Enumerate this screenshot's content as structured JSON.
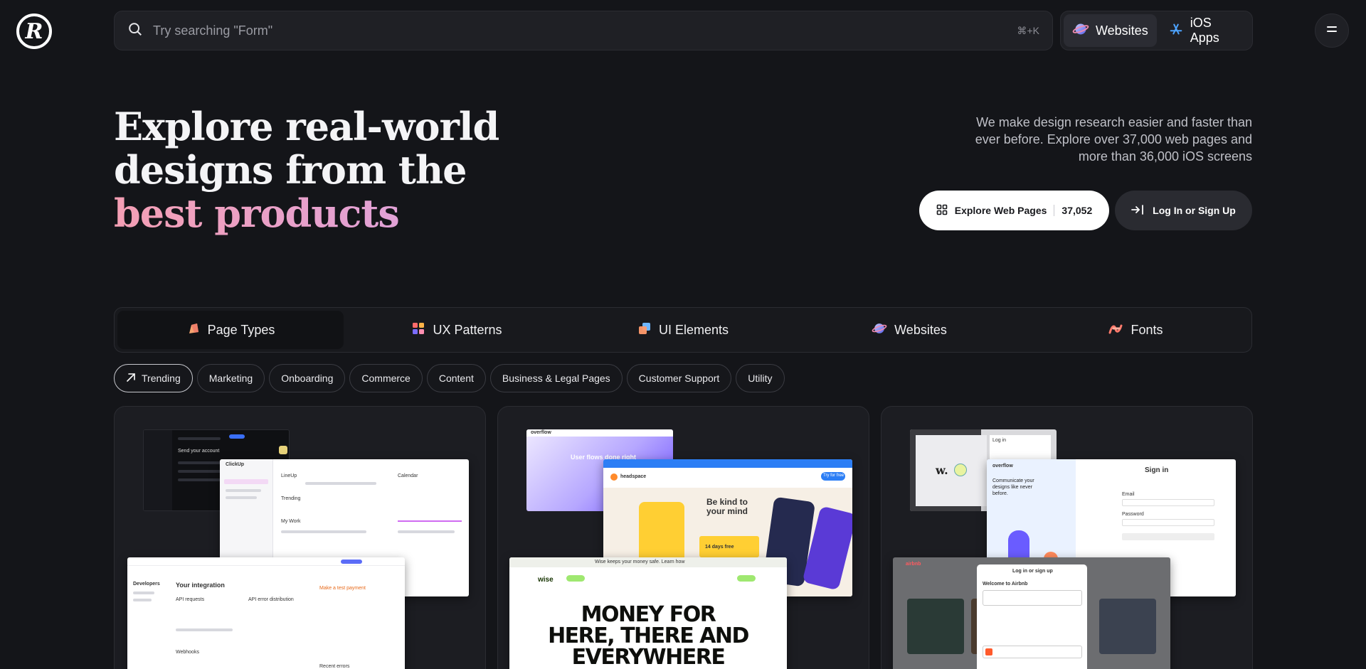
{
  "header": {
    "logo_letter": "R",
    "search": {
      "placeholder": "Try searching \"Form\"",
      "shortcut": "⌘+K",
      "icon": "search-icon"
    },
    "platforms": [
      {
        "label": "Websites",
        "icon": "planet-icon",
        "active": true
      },
      {
        "label": "iOS Apps",
        "icon": "app-store-icon",
        "active": false
      }
    ],
    "menu_icon": "menu-icon"
  },
  "hero": {
    "title_line1": "Explore real-world",
    "title_line2": "designs from the",
    "title_highlight": "best products",
    "description": "We make design research easier and faster than ever before. Explore over 37,000 web pages and more than 36,000 iOS screens",
    "explore_button": {
      "label": "Explore Web Pages",
      "count": "37,052",
      "icon": "grid-icon"
    },
    "login_button": {
      "label": "Log In or Sign Up",
      "icon": "login-arrow-icon"
    }
  },
  "categories": [
    {
      "label": "Page Types",
      "icon": "page-types-icon",
      "active": true
    },
    {
      "label": "UX Patterns",
      "icon": "ux-patterns-icon",
      "active": false
    },
    {
      "label": "UI Elements",
      "icon": "ui-elements-icon",
      "active": false
    },
    {
      "label": "Websites",
      "icon": "planet-icon",
      "active": false
    },
    {
      "label": "Fonts",
      "icon": "fonts-icon",
      "active": false
    }
  ],
  "filters": [
    {
      "label": "Trending",
      "icon": "trending-arrow-icon",
      "active": true
    },
    {
      "label": "Marketing",
      "active": false
    },
    {
      "label": "Onboarding",
      "active": false
    },
    {
      "label": "Commerce",
      "active": false
    },
    {
      "label": "Content",
      "active": false
    },
    {
      "label": "Business & Legal Pages",
      "active": false
    },
    {
      "label": "Customer Support",
      "active": false
    },
    {
      "label": "Utility",
      "active": false
    }
  ],
  "cards": {
    "card1": {
      "shot_a_text": "Send your account",
      "shot_b_app": "ClickUp",
      "shot_b_heading": "LineUp",
      "shot_b_trending": "Trending",
      "shot_b_mywork": "My Work",
      "shot_b_calendar": "Calendar",
      "shot_c_title": "Your integration",
      "shot_c_sidebar_title": "Developers",
      "shot_c_subtitle": "Make a test payment",
      "shot_c_section": "API requests",
      "shot_c_section2": "API error distribution",
      "shot_c_section3": "Webhooks",
      "shot_c_errors": "Recent errors"
    },
    "card2": {
      "shot_a_brand": "overflow",
      "shot_a_headline": "User flows done right",
      "shot_b_brand": "headspace",
      "shot_b_headline": "Be kind to your mind",
      "shot_b_cta": "Try for free",
      "shot_b_offer": "14 days free",
      "shot_c_banner": "Wise keeps your money safe. Learn how",
      "shot_c_brand": "wise",
      "shot_c_headline": "MONEY FOR HERE, THERE AND EVERYWHERE"
    },
    "card3": {
      "shot_a_logo": "w.",
      "shot_a_label": "Log in",
      "shot_b_brand": "overflow",
      "shot_b_tagline": "Communicate your designs like never before.",
      "shot_b_signin": "Sign in",
      "shot_b_email": "Email",
      "shot_b_password": "Password",
      "shot_c_brand": "airbnb",
      "shot_c_modal_title": "Log in or sign up",
      "shot_c_modal_welcome": "Welcome to Airbnb"
    }
  },
  "colors": {
    "background": "#141519",
    "surface": "#1f2025",
    "accent_gradient_start": "#f49fb4",
    "accent_gradient_end": "#d7a3ea",
    "primary_button": "#ffffff"
  }
}
